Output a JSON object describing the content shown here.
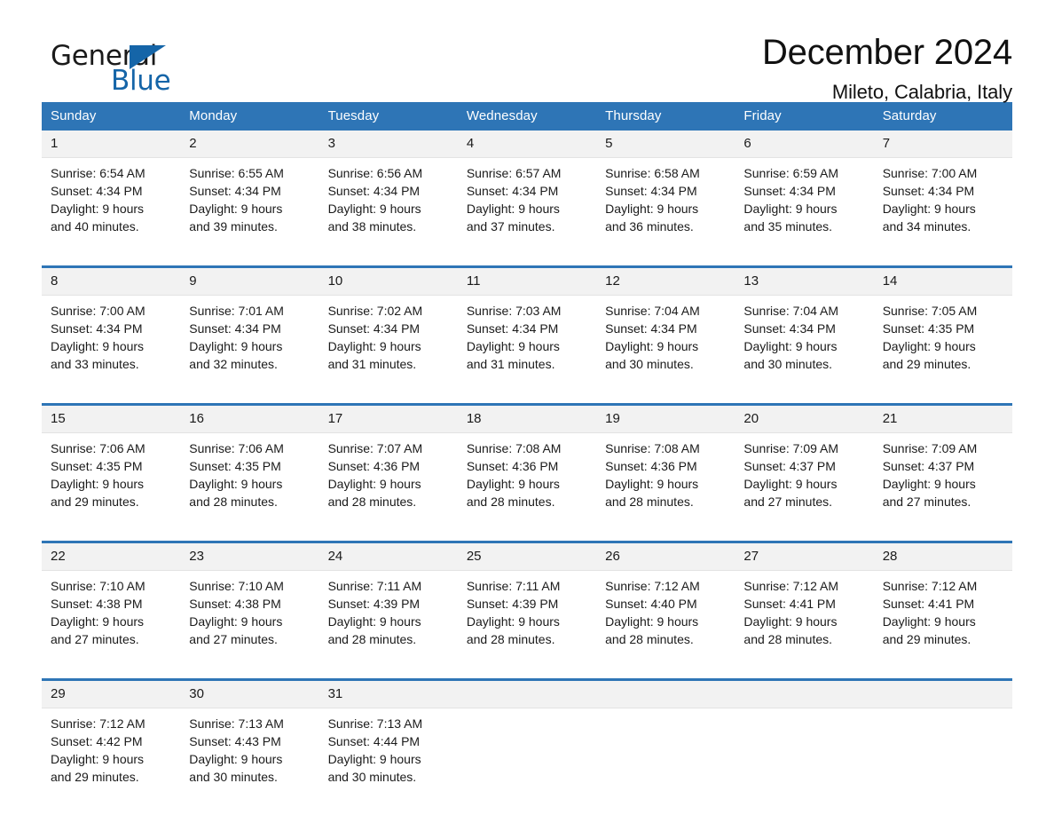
{
  "brand": {
    "word_one": "General",
    "word_two": "Blue",
    "logo_icon": "triangle-logo-icon",
    "accent_color": "#1565a8"
  },
  "header": {
    "title": "December 2024",
    "subtitle": "Mileto, Calabria, Italy"
  },
  "colors": {
    "header_blue": "#2e75b6",
    "row_rule_blue": "#2e75b6",
    "date_band_gray": "#f2f2f2",
    "text": "#1a1a1a"
  },
  "weekday_headers": [
    "Sunday",
    "Monday",
    "Tuesday",
    "Wednesday",
    "Thursday",
    "Friday",
    "Saturday"
  ],
  "weeks": [
    [
      {
        "day": "1",
        "sunrise": "Sunrise: 6:54 AM",
        "sunset": "Sunset: 4:34 PM",
        "daylight_line1": "Daylight: 9 hours",
        "daylight_line2": "and 40 minutes."
      },
      {
        "day": "2",
        "sunrise": "Sunrise: 6:55 AM",
        "sunset": "Sunset: 4:34 PM",
        "daylight_line1": "Daylight: 9 hours",
        "daylight_line2": "and 39 minutes."
      },
      {
        "day": "3",
        "sunrise": "Sunrise: 6:56 AM",
        "sunset": "Sunset: 4:34 PM",
        "daylight_line1": "Daylight: 9 hours",
        "daylight_line2": "and 38 minutes."
      },
      {
        "day": "4",
        "sunrise": "Sunrise: 6:57 AM",
        "sunset": "Sunset: 4:34 PM",
        "daylight_line1": "Daylight: 9 hours",
        "daylight_line2": "and 37 minutes."
      },
      {
        "day": "5",
        "sunrise": "Sunrise: 6:58 AM",
        "sunset": "Sunset: 4:34 PM",
        "daylight_line1": "Daylight: 9 hours",
        "daylight_line2": "and 36 minutes."
      },
      {
        "day": "6",
        "sunrise": "Sunrise: 6:59 AM",
        "sunset": "Sunset: 4:34 PM",
        "daylight_line1": "Daylight: 9 hours",
        "daylight_line2": "and 35 minutes."
      },
      {
        "day": "7",
        "sunrise": "Sunrise: 7:00 AM",
        "sunset": "Sunset: 4:34 PM",
        "daylight_line1": "Daylight: 9 hours",
        "daylight_line2": "and 34 minutes."
      }
    ],
    [
      {
        "day": "8",
        "sunrise": "Sunrise: 7:00 AM",
        "sunset": "Sunset: 4:34 PM",
        "daylight_line1": "Daylight: 9 hours",
        "daylight_line2": "and 33 minutes."
      },
      {
        "day": "9",
        "sunrise": "Sunrise: 7:01 AM",
        "sunset": "Sunset: 4:34 PM",
        "daylight_line1": "Daylight: 9 hours",
        "daylight_line2": "and 32 minutes."
      },
      {
        "day": "10",
        "sunrise": "Sunrise: 7:02 AM",
        "sunset": "Sunset: 4:34 PM",
        "daylight_line1": "Daylight: 9 hours",
        "daylight_line2": "and 31 minutes."
      },
      {
        "day": "11",
        "sunrise": "Sunrise: 7:03 AM",
        "sunset": "Sunset: 4:34 PM",
        "daylight_line1": "Daylight: 9 hours",
        "daylight_line2": "and 31 minutes."
      },
      {
        "day": "12",
        "sunrise": "Sunrise: 7:04 AM",
        "sunset": "Sunset: 4:34 PM",
        "daylight_line1": "Daylight: 9 hours",
        "daylight_line2": "and 30 minutes."
      },
      {
        "day": "13",
        "sunrise": "Sunrise: 7:04 AM",
        "sunset": "Sunset: 4:34 PM",
        "daylight_line1": "Daylight: 9 hours",
        "daylight_line2": "and 30 minutes."
      },
      {
        "day": "14",
        "sunrise": "Sunrise: 7:05 AM",
        "sunset": "Sunset: 4:35 PM",
        "daylight_line1": "Daylight: 9 hours",
        "daylight_line2": "and 29 minutes."
      }
    ],
    [
      {
        "day": "15",
        "sunrise": "Sunrise: 7:06 AM",
        "sunset": "Sunset: 4:35 PM",
        "daylight_line1": "Daylight: 9 hours",
        "daylight_line2": "and 29 minutes."
      },
      {
        "day": "16",
        "sunrise": "Sunrise: 7:06 AM",
        "sunset": "Sunset: 4:35 PM",
        "daylight_line1": "Daylight: 9 hours",
        "daylight_line2": "and 28 minutes."
      },
      {
        "day": "17",
        "sunrise": "Sunrise: 7:07 AM",
        "sunset": "Sunset: 4:36 PM",
        "daylight_line1": "Daylight: 9 hours",
        "daylight_line2": "and 28 minutes."
      },
      {
        "day": "18",
        "sunrise": "Sunrise: 7:08 AM",
        "sunset": "Sunset: 4:36 PM",
        "daylight_line1": "Daylight: 9 hours",
        "daylight_line2": "and 28 minutes."
      },
      {
        "day": "19",
        "sunrise": "Sunrise: 7:08 AM",
        "sunset": "Sunset: 4:36 PM",
        "daylight_line1": "Daylight: 9 hours",
        "daylight_line2": "and 28 minutes."
      },
      {
        "day": "20",
        "sunrise": "Sunrise: 7:09 AM",
        "sunset": "Sunset: 4:37 PM",
        "daylight_line1": "Daylight: 9 hours",
        "daylight_line2": "and 27 minutes."
      },
      {
        "day": "21",
        "sunrise": "Sunrise: 7:09 AM",
        "sunset": "Sunset: 4:37 PM",
        "daylight_line1": "Daylight: 9 hours",
        "daylight_line2": "and 27 minutes."
      }
    ],
    [
      {
        "day": "22",
        "sunrise": "Sunrise: 7:10 AM",
        "sunset": "Sunset: 4:38 PM",
        "daylight_line1": "Daylight: 9 hours",
        "daylight_line2": "and 27 minutes."
      },
      {
        "day": "23",
        "sunrise": "Sunrise: 7:10 AM",
        "sunset": "Sunset: 4:38 PM",
        "daylight_line1": "Daylight: 9 hours",
        "daylight_line2": "and 27 minutes."
      },
      {
        "day": "24",
        "sunrise": "Sunrise: 7:11 AM",
        "sunset": "Sunset: 4:39 PM",
        "daylight_line1": "Daylight: 9 hours",
        "daylight_line2": "and 28 minutes."
      },
      {
        "day": "25",
        "sunrise": "Sunrise: 7:11 AM",
        "sunset": "Sunset: 4:39 PM",
        "daylight_line1": "Daylight: 9 hours",
        "daylight_line2": "and 28 minutes."
      },
      {
        "day": "26",
        "sunrise": "Sunrise: 7:12 AM",
        "sunset": "Sunset: 4:40 PM",
        "daylight_line1": "Daylight: 9 hours",
        "daylight_line2": "and 28 minutes."
      },
      {
        "day": "27",
        "sunrise": "Sunrise: 7:12 AM",
        "sunset": "Sunset: 4:41 PM",
        "daylight_line1": "Daylight: 9 hours",
        "daylight_line2": "and 28 minutes."
      },
      {
        "day": "28",
        "sunrise": "Sunrise: 7:12 AM",
        "sunset": "Sunset: 4:41 PM",
        "daylight_line1": "Daylight: 9 hours",
        "daylight_line2": "and 29 minutes."
      }
    ],
    [
      {
        "day": "29",
        "sunrise": "Sunrise: 7:12 AM",
        "sunset": "Sunset: 4:42 PM",
        "daylight_line1": "Daylight: 9 hours",
        "daylight_line2": "and 29 minutes."
      },
      {
        "day": "30",
        "sunrise": "Sunrise: 7:13 AM",
        "sunset": "Sunset: 4:43 PM",
        "daylight_line1": "Daylight: 9 hours",
        "daylight_line2": "and 30 minutes."
      },
      {
        "day": "31",
        "sunrise": "Sunrise: 7:13 AM",
        "sunset": "Sunset: 4:44 PM",
        "daylight_line1": "Daylight: 9 hours",
        "daylight_line2": "and 30 minutes."
      },
      {
        "day": "",
        "sunrise": "",
        "sunset": "",
        "daylight_line1": "",
        "daylight_line2": ""
      },
      {
        "day": "",
        "sunrise": "",
        "sunset": "",
        "daylight_line1": "",
        "daylight_line2": ""
      },
      {
        "day": "",
        "sunrise": "",
        "sunset": "",
        "daylight_line1": "",
        "daylight_line2": ""
      },
      {
        "day": "",
        "sunrise": "",
        "sunset": "",
        "daylight_line1": "",
        "daylight_line2": ""
      }
    ]
  ]
}
